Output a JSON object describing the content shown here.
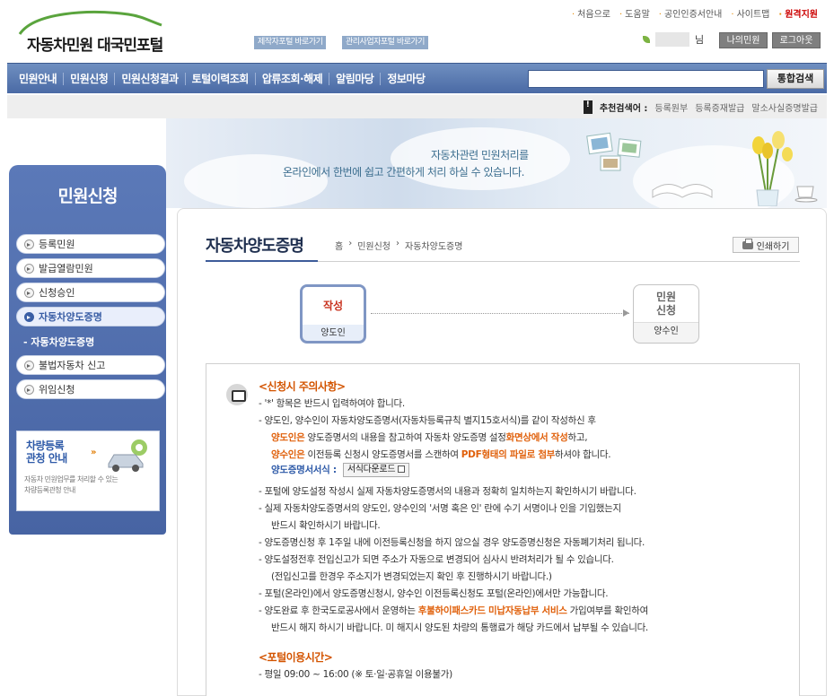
{
  "header": {
    "logo_text": "자동차민원 대국민포털",
    "btn_production": "제작자포털 바로가기",
    "btn_management": "관리사업자포털 바로가기",
    "toplinks": [
      "처음으로",
      "도움말",
      "공인인증서안내",
      "사이트맵"
    ],
    "remote_support": "원격지원",
    "user_suffix": "님",
    "btn_mypage": "나의민원",
    "btn_logout": "로그아웃"
  },
  "nav": {
    "items": [
      "민원안내",
      "민원신청",
      "민원신청결과",
      "토털이력조회",
      "압류조회·해제",
      "알림마당",
      "정보마당"
    ],
    "search_placeholder": "",
    "search_button": "통합검색"
  },
  "recommend": {
    "mark": "!",
    "label": "추천검색어 :",
    "keywords": [
      "등록원부",
      "등록증재발급",
      "말소사실증명발급"
    ]
  },
  "banner": {
    "line1": "자동차관련 민원처리를",
    "line2": "온라인에서 한번에 쉽고 간편하게 처리 하실 수 있습니다."
  },
  "sidebar": {
    "title": "민원신청",
    "items": [
      "등록민원",
      "발급열람민원",
      "신청승인",
      "자동차양도증명",
      "불법자동차 신고",
      "위임신청"
    ],
    "active_index": 3,
    "sub_item": "- 자동차양도증명",
    "promo_title_1": "차량등록",
    "promo_title_2": "관청 안내",
    "promo_desc_1": "자동차 민원업무를 처리할 수 있는",
    "promo_desc_2": "차량등록관청 안내"
  },
  "page": {
    "title": "자동차양도증명",
    "breadcrumb": [
      "홈",
      "민원신청",
      "자동차양도증명"
    ],
    "print": "인쇄하기"
  },
  "steps": [
    {
      "main_1": "작성",
      "main_2": "",
      "sub": "양도인"
    },
    {
      "main_1": "민원",
      "main_2": "신청",
      "sub": "양수인"
    }
  ],
  "notice": {
    "head1": "<신청시 주의사항>",
    "l1": "- '*' 항목은 반드시 입력하여야 합니다.",
    "l2": "- 양도인, 양수인이 자동차양도증명서(자동차등록규칙 별지15호서식)를 같이 작성하신 후",
    "l3_hl": "양도인은",
    "l3_a": " 양도증명서의 내용을 참고하여 자동차 양도증명 설정",
    "l3_hl2": "화면상에서 작성",
    "l3_b": "하고,",
    "l4_hl": "양수인은",
    "l4_a": " 이전등록 신청시 양도증명서를 스캔하여 ",
    "l4_hl2": "PDF형태의 파일로 첨부",
    "l4_b": "하셔야 합니다.",
    "form_label": "양도증명서서식 :",
    "download": "서식다운로드",
    "l5": "- 포털에 양도설정 작성시 실제 자동차양도증명서의 내용과 정확히 일치하는지 확인하시기 바랍니다.",
    "l6": "- 실제 자동차양도증명서의 양도인, 양수인의 '서명 혹은 인' 란에 수기 서명이나 인을 기입했는지",
    "l6b": "반드시 확인하시기 바랍니다.",
    "l7": "- 양도증명신청 후 1주일 내에 이전등록신청을 하지 않으실 경우 양도증명신청은 자동폐기처리 됩니다.",
    "l8": "- 양도설정전후 전입신고가 되면 주소가 자동으로 변경되어 심사시 반려처리가 될 수 있습니다.",
    "l8b": "(전입신고를 한경우 주소지가 변경되었는지 확인 후 진행하시기 바랍니다.)",
    "l9": "- 포털(온라인)에서 양도증명신청시, 양수인 이전등록신청도 포털(온라인)에서만 가능합니다.",
    "l10_a": "- 양도완료 후 한국도로공사에서 운영하는 ",
    "l10_hl": "후불하이패스카드 미납자동납부 서비스",
    "l10_b": " 가입여부를 확인하여",
    "l10c": "반드시 해지 하시기 바랍니다. 미 해지시 양도된 차량의 통행료가 해당 카드에서 납부될 수 있습니다.",
    "head2": "<포털이용시간>",
    "l11": "- 평일 09:00 ~ 16:00 (※ 토·일·공휴일 이용불가)"
  },
  "colors": {
    "nav_blue": "#4a6aa5",
    "accent_orange": "#d35400",
    "remote_red": "#cc0000",
    "title_navy": "#1f2f4f"
  }
}
